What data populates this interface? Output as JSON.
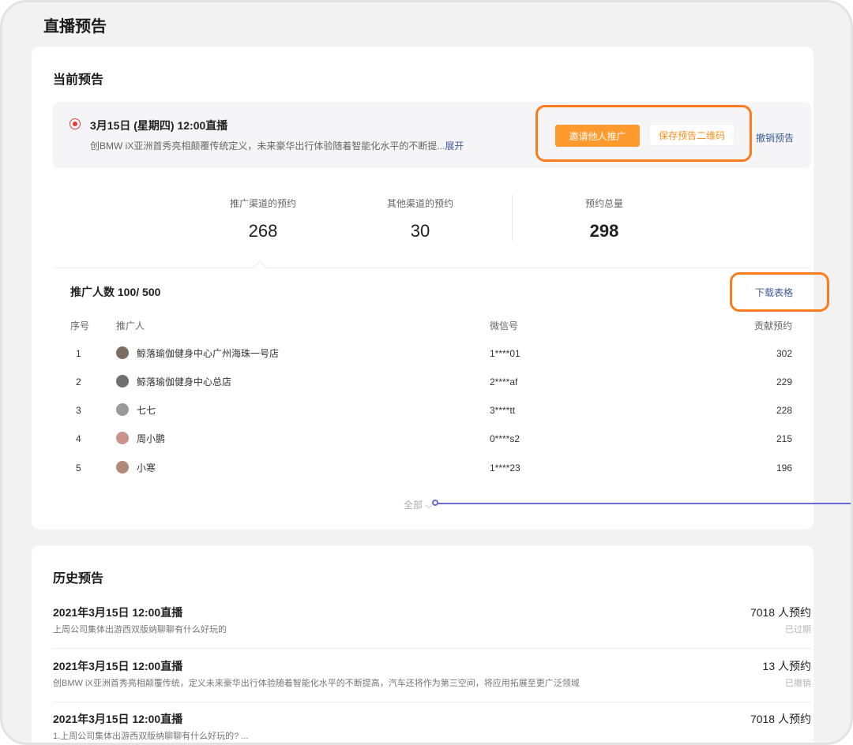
{
  "page": {
    "title": "直播预告"
  },
  "current": {
    "section_title": "当前预告",
    "preview": {
      "title": "3月15日 (星期四) 12:00直播",
      "desc": "创BMW iX亚洲首秀亮相颠覆传统定义，未来豪华出行体验随着智能化水平的不断提...",
      "expand_label": "展开"
    },
    "actions": {
      "invite_label": "邀请他人推广",
      "save_qr_label": "保存预告二维码",
      "cancel_label": "撤销预告"
    },
    "stats": [
      {
        "label": "推广渠道的预约",
        "value": "268"
      },
      {
        "label": "其他渠道的预约",
        "value": "30"
      },
      {
        "label": "预约总量",
        "value": "298"
      }
    ],
    "promoters": {
      "count_label": "推广人数 100/ 500",
      "download_label": "下载表格",
      "columns": [
        "序号",
        "推广人",
        "微信号",
        "贡献预约"
      ],
      "rows": [
        {
          "index": "1",
          "name": "鲸落瑜伽健身中心广州海珠一号店",
          "wechat": "1****01",
          "contrib": "302"
        },
        {
          "index": "2",
          "name": "鲸落瑜伽健身中心总店",
          "wechat": "2****af",
          "contrib": "229"
        },
        {
          "index": "3",
          "name": "七七",
          "wechat": "3****tt",
          "contrib": "228"
        },
        {
          "index": "4",
          "name": "周小鹏",
          "wechat": "0****s2",
          "contrib": "215"
        },
        {
          "index": "5",
          "name": "小寒",
          "wechat": "1****23",
          "contrib": "196"
        }
      ],
      "show_all_label": "全部 ⌵"
    }
  },
  "history": {
    "section_title": "历史预告",
    "items": [
      {
        "title": "2021年3月15日 12:00直播",
        "desc": "上周公司集体出游西双版纳聊聊有什么好玩的",
        "count": "7018 人预约",
        "status": "已过期"
      },
      {
        "title": "2021年3月15日 12:00直播",
        "desc": "创BMW iX亚洲首秀亮相颠覆传统，定义未来豪华出行体验随着智能化水平的不断提高，汽车还将作为第三空间，将应用拓展至更广泛领域",
        "count": "13 人预约",
        "status": "已撤销"
      },
      {
        "title": "2021年3月15日 12:00直播",
        "desc": "1.上周公司集体出游西双版纳聊聊有什么好玩的? ...",
        "count": "7018 人预约",
        "status": ""
      }
    ]
  },
  "colors": {
    "accent_orange": "#ff9a2e",
    "highlight_orange": "#ff7a1a",
    "link_blue": "#3d5a99",
    "live_red": "#e53935",
    "pointer_purple": "#6b6bd8"
  }
}
